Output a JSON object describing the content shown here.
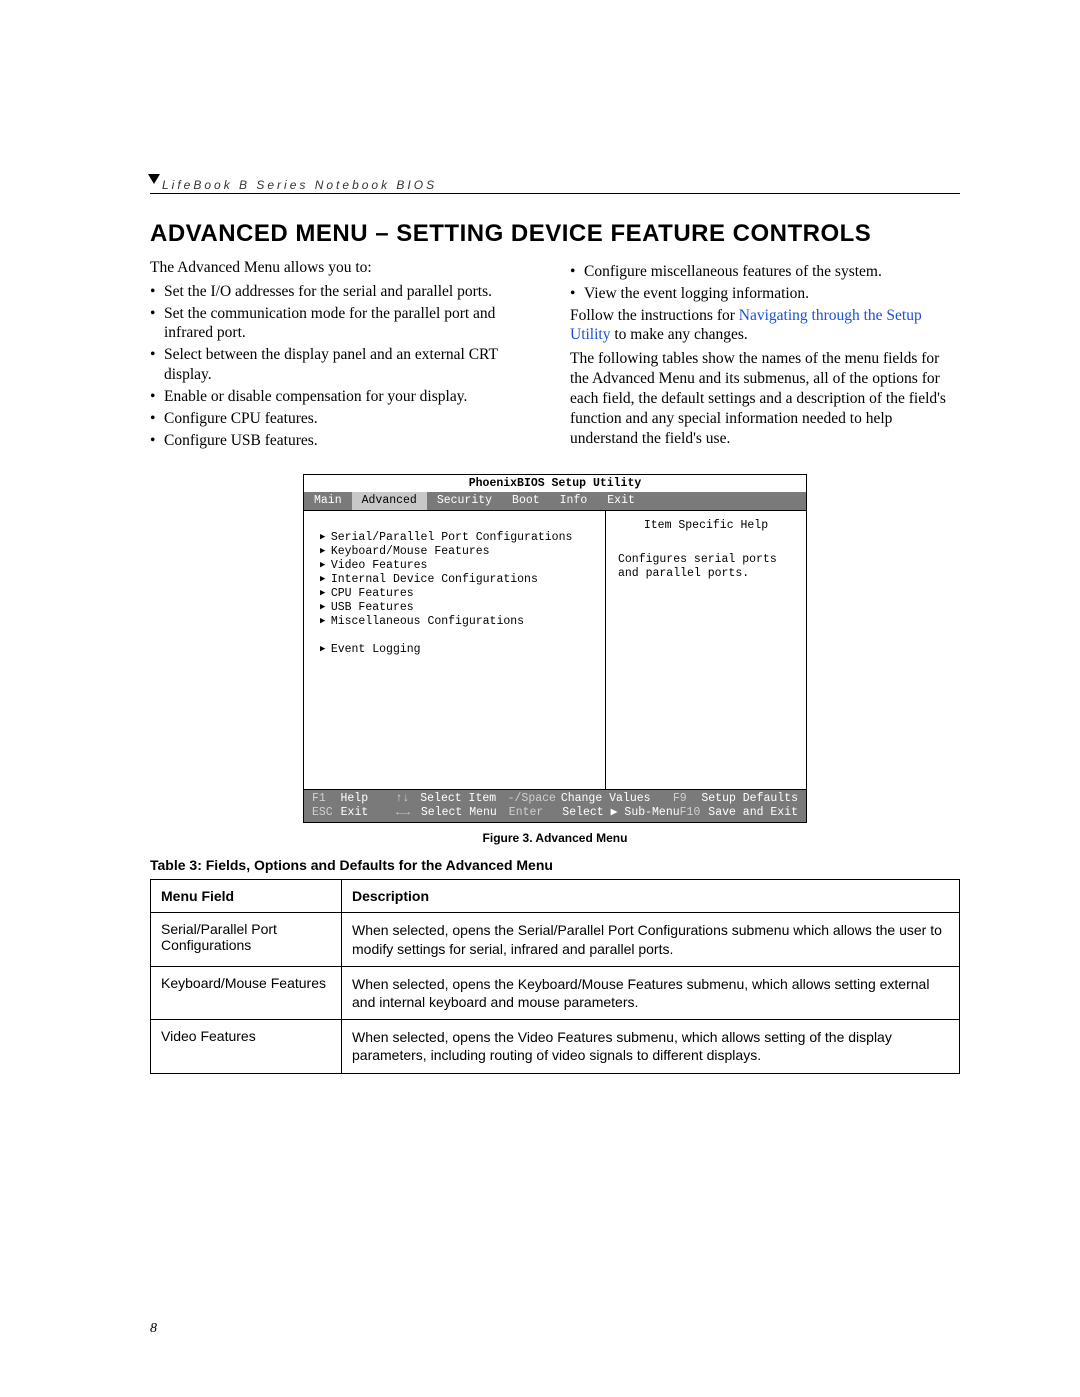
{
  "running_head": "LifeBook B Series Notebook BIOS",
  "title": "ADVANCED MENU – SETTING DEVICE FEATURE CONTROLS",
  "intro_left": "The Advanced Menu allows you to:",
  "bullets_left": [
    "Set the I/O addresses for the serial and parallel ports.",
    "Set the communication mode for the parallel port and infrared port.",
    "Select between the display panel and an external CRT display.",
    "Enable or disable compensation for your display.",
    "Configure CPU features.",
    "Configure USB features."
  ],
  "bullets_right": [
    "Configure miscellaneous features of the system.",
    "View the event logging information."
  ],
  "follow_pre": "Follow the instructions for ",
  "follow_link": "Navigating through the Setup Utility",
  "follow_post": " to make any changes.",
  "para_right": "The following tables show the names of the menu fields for the Advanced Menu and its submenus, all of the options for each field, the default settings and a description of the field's function and any special information needed to help understand the field's use.",
  "bios": {
    "title": "PhoenixBIOS Setup Utility",
    "tabs": [
      "Main",
      "Advanced",
      "Security",
      "Boot",
      "Info",
      "Exit"
    ],
    "active_tab": "Advanced",
    "items": [
      "Serial/Parallel Port Configurations",
      "Keyboard/Mouse Features",
      "Video Features",
      "Internal Device Configurations",
      "CPU Features",
      "USB Features",
      "Miscellaneous Configurations"
    ],
    "items2": [
      "Event Logging"
    ],
    "help_title": "Item Specific Help",
    "help_text": "Configures serial ports and parallel ports.",
    "footer": {
      "r1k1": "F1",
      "r1v1": "Help",
      "r1k2": "↑↓",
      "r1v2": "Select Item",
      "r1k3": "-/Space",
      "r1v3": "Change Values",
      "r1k4": "F9",
      "r1v4": "Setup Defaults",
      "r2k1": "ESC",
      "r2v1": "Exit",
      "r2k2": "←→",
      "r2v2": "Select Menu",
      "r2k3": "Enter",
      "r2v3": "Select ▶ Sub-Menu",
      "r2k4": "F10",
      "r2v4": "Save and Exit"
    }
  },
  "figure_caption": "Figure 3.  Advanced Menu",
  "table_caption": "Table 3: Fields, Options and Defaults for the Advanced Menu",
  "table": {
    "head": [
      "Menu Field",
      "Description"
    ],
    "rows": [
      [
        "Serial/Parallel Port Configurations",
        "When selected, opens the Serial/Parallel Port Configurations submenu which allows the user to modify settings for serial, infrared and parallel ports."
      ],
      [
        "Keyboard/Mouse Features",
        "When selected, opens the Keyboard/Mouse Features submenu, which allows setting external and internal keyboard and mouse parameters."
      ],
      [
        "Video Features",
        "When selected, opens the Video Features submenu, which allows setting of the display parameters, including routing of video signals to different displays."
      ]
    ]
  },
  "page_number": "8"
}
